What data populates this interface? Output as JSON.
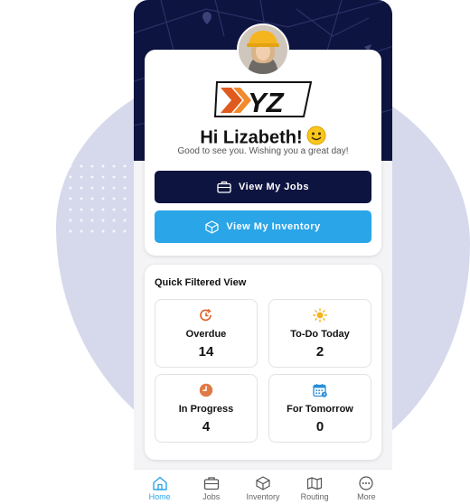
{
  "brand": {
    "logo_text": "XYZ"
  },
  "greeting": {
    "title": "Hi Lizabeth!",
    "subtitle": "Good to see you. Wishing you a great day!"
  },
  "buttons": {
    "jobs_label": "View My Jobs",
    "inventory_label": "View My Inventory"
  },
  "quick": {
    "title": "Quick Filtered View",
    "tiles": [
      {
        "label": "Overdue",
        "count": "14",
        "icon": "overdue-clock-icon"
      },
      {
        "label": "To-Do Today",
        "count": "2",
        "icon": "sun-icon"
      },
      {
        "label": "In Progress",
        "count": "4",
        "icon": "clock-icon"
      },
      {
        "label": "For Tomorrow",
        "count": "0",
        "icon": "calendar-icon"
      }
    ]
  },
  "tabs": [
    {
      "label": "Home",
      "icon": "home-icon",
      "active": true
    },
    {
      "label": "Jobs",
      "icon": "briefcase-icon",
      "active": false
    },
    {
      "label": "Inventory",
      "icon": "box-icon",
      "active": false
    },
    {
      "label": "Routing",
      "icon": "map-icon",
      "active": false
    },
    {
      "label": "More",
      "icon": "more-icon",
      "active": false
    }
  ],
  "colors": {
    "navy": "#0e1440",
    "blue": "#2aa5e8",
    "orange": "#e05a1e",
    "blob": "#d6d9ec"
  }
}
